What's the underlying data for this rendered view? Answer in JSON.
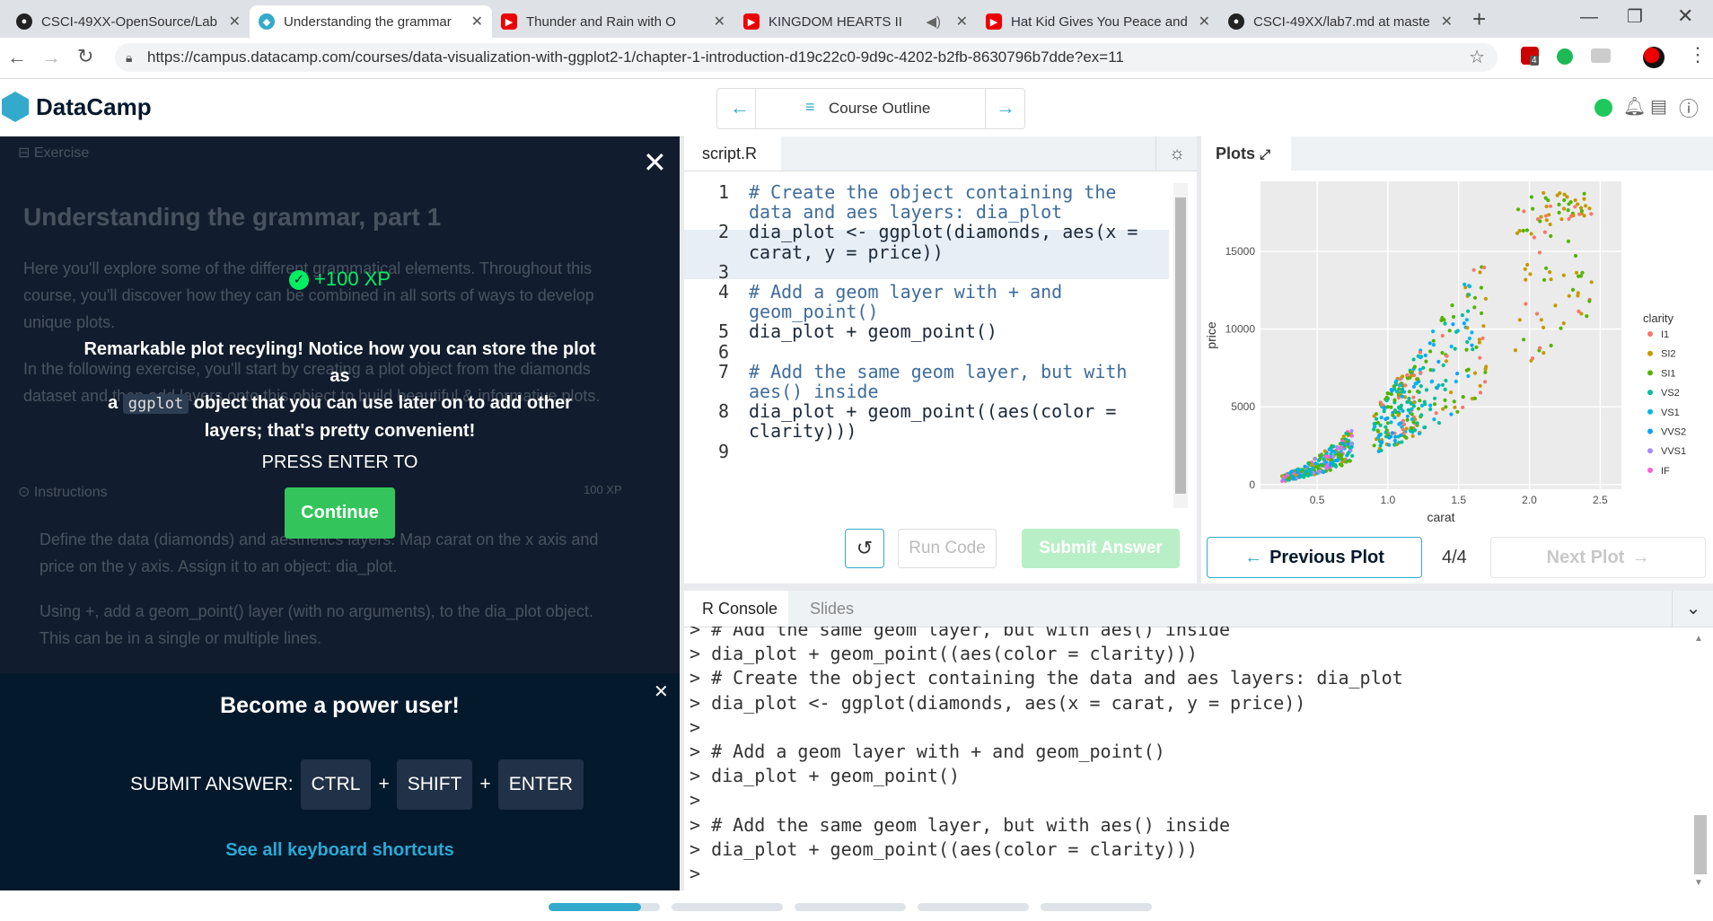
{
  "browser": {
    "tabs": [
      {
        "title": "CSCI-49XX-OpenSource/Lab",
        "icon": "github-icon"
      },
      {
        "title": "Understanding the grammar",
        "icon": "datacamp-icon"
      },
      {
        "title": "Thunder and Rain with O",
        "icon": "youtube-icon"
      },
      {
        "title": "KINGDOM HEARTS II",
        "icon": "youtube-icon"
      },
      {
        "title": "Hat Kid Gives You Peace and",
        "icon": "youtube-icon"
      },
      {
        "title": "CSCI-49XX/lab7.md at maste",
        "icon": "github-icon"
      }
    ],
    "url": "https://campus.datacamp.com/courses/data-visualization-with-ggplot2-1/chapter-1-introduction-d19c22c0-9d9c-4202-b2fb-8630796b7dde?ex=11",
    "extension_badge": "4"
  },
  "header": {
    "logo": "DataCamp",
    "course_outline": "Course Outline"
  },
  "exercise": {
    "tab_label": "Exercise",
    "title": "Understanding the grammar, part 1",
    "intro_1": "Here you'll explore some of the different grammatical elements. Throughout this course, you'll discover how they can be combined in all sorts of ways to develop unique plots.",
    "intro_2": "In the following exercise, you'll start by creating a plot object from the diamonds dataset and then add layers onto this object to build beautiful & informative plots.",
    "instructions_label": "Instructions",
    "instructions_xp": "100 XP",
    "bullet_1": "Define the data (diamonds) and aesthetics layers. Map carat on the x axis and price on the y axis. Assign it to an object: dia_plot.",
    "bullet_2": "Using +, add a geom_point() layer (with no arguments), to the dia_plot object. This can be in a single or multiple lines."
  },
  "feedback": {
    "xp": "+100 XP",
    "message_1": "Remarkable plot recyling! Notice how you can store the plot as",
    "message_prefix": "a",
    "code_word": "ggplot",
    "message_2": "object that you can use later on to add other",
    "message_3": "layers; that's pretty convenient!",
    "press_enter": "PRESS ENTER TO",
    "continue": "Continue"
  },
  "power_user": {
    "title": "Become a power user!",
    "submit_label": "SUBMIT ANSWER:",
    "keys": [
      "CTRL",
      "SHIFT",
      "ENTER"
    ],
    "plus": "+",
    "shortcuts_link": "See all keyboard shortcuts"
  },
  "editor": {
    "filename": "script.R",
    "lines": [
      {
        "num": "1",
        "text": "# Create the object containing the",
        "comment": true
      },
      {
        "num": "",
        "text": "data and aes layers: dia_plot",
        "comment": true
      },
      {
        "num": "2",
        "text": "dia_plot <- ggplot(diamonds, aes(x =",
        "comment": false
      },
      {
        "num": "",
        "text": "carat, y = price))",
        "comment": false
      },
      {
        "num": "3",
        "text": "",
        "comment": false
      },
      {
        "num": "4",
        "text": "# Add a geom layer with + and",
        "comment": true
      },
      {
        "num": "",
        "text": "geom_point()",
        "comment": true
      },
      {
        "num": "5",
        "text": "dia_plot + geom_point()",
        "comment": false
      },
      {
        "num": "6",
        "text": "",
        "comment": false
      },
      {
        "num": "7",
        "text": "# Add the same geom layer, but with",
        "comment": true
      },
      {
        "num": "",
        "text": "aes() inside",
        "comment": true
      },
      {
        "num": "8",
        "text": "dia_plot + geom_point((aes(color =",
        "comment": false
      },
      {
        "num": "",
        "text": "clarity)))",
        "comment": false
      },
      {
        "num": "9",
        "text": "",
        "comment": false
      }
    ],
    "run_code": "Run Code",
    "submit_answer": "Submit Answer"
  },
  "plots_panel": {
    "tab_label": "Plots",
    "previous": "Previous Plot",
    "counter": "4/4",
    "next": "Next Plot",
    "plot": {
      "xlabel": "carat",
      "ylabel": "price",
      "xticks": [
        "0.5",
        "1.0",
        "1.5",
        "2.0",
        "2.5"
      ],
      "yticks": [
        "0",
        "5000",
        "10000",
        "15000"
      ],
      "legend_title": "clarity",
      "legend": [
        {
          "label": "I1",
          "color": "#f8766d"
        },
        {
          "label": "SI2",
          "color": "#c49a00"
        },
        {
          "label": "SI1",
          "color": "#53b400"
        },
        {
          "label": "VS2",
          "color": "#00c094"
        },
        {
          "label": "VS1",
          "color": "#00b6eb"
        },
        {
          "label": "VVS2",
          "color": "#06a4ff"
        },
        {
          "label": "VVS1",
          "color": "#a58aff"
        },
        {
          "label": "IF",
          "color": "#fb61d7"
        }
      ]
    }
  },
  "console": {
    "tabs": [
      "R Console",
      "Slides"
    ],
    "lines": [
      "> # Add the same geom layer, but with aes() inside",
      "> dia_plot + geom_point((aes(color = clarity)))",
      "> # Create the object containing the data and aes layers: dia_plot",
      "> dia_plot <- ggplot(diamonds, aes(x = carat, y = price))",
      ">",
      "> # Add a geom layer with + and geom_point()",
      "> dia_plot + geom_point()",
      ">",
      "> # Add the same geom layer, but with aes() inside",
      "> dia_plot + geom_point((aes(color = clarity)))",
      ">"
    ]
  },
  "colors": {
    "accent": "#03ef62",
    "brand_blue": "#05192d",
    "link": "#2ba9d6",
    "continue_green": "#33c55b"
  }
}
